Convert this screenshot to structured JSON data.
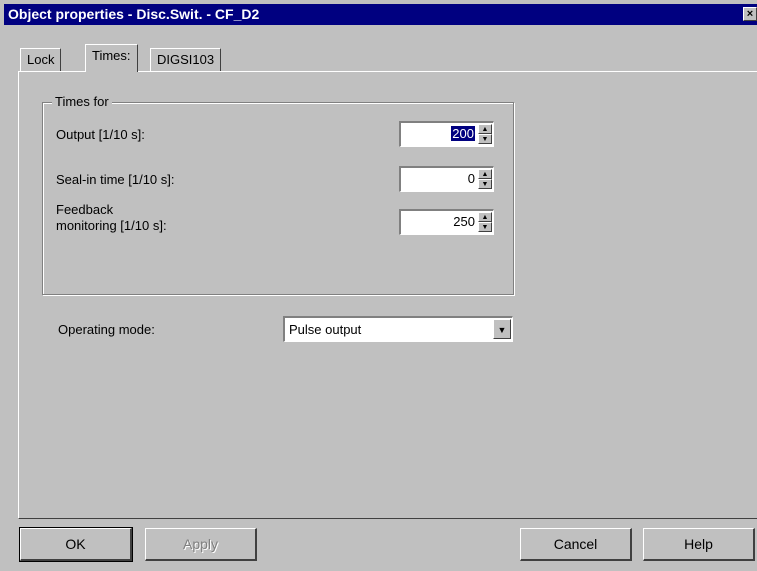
{
  "window": {
    "title": "Object properties - Disc.Swit. - CF_D2",
    "close_glyph": "×"
  },
  "tabs": [
    {
      "label": "Lock",
      "active": false
    },
    {
      "label": "Times:",
      "active": true
    },
    {
      "label": "DIGSI103",
      "active": false
    }
  ],
  "times_group": {
    "label": "Times for",
    "output": {
      "label": "Output [1/10 s]:",
      "value": "200"
    },
    "seal_in": {
      "label": "Seal-in time [1/10 s]:",
      "value": "0"
    },
    "feedback": {
      "label_line1": "Feedback",
      "label_line2": "monitoring [1/10 s]:",
      "value": "250"
    }
  },
  "operating_mode": {
    "label": "Operating mode:",
    "value": "Pulse output"
  },
  "buttons": {
    "ok": "OK",
    "apply": "Apply",
    "cancel": "Cancel",
    "help": "Help"
  },
  "icons": {
    "spin_up": "▲",
    "spin_down": "▼",
    "dropdown": "▼"
  }
}
